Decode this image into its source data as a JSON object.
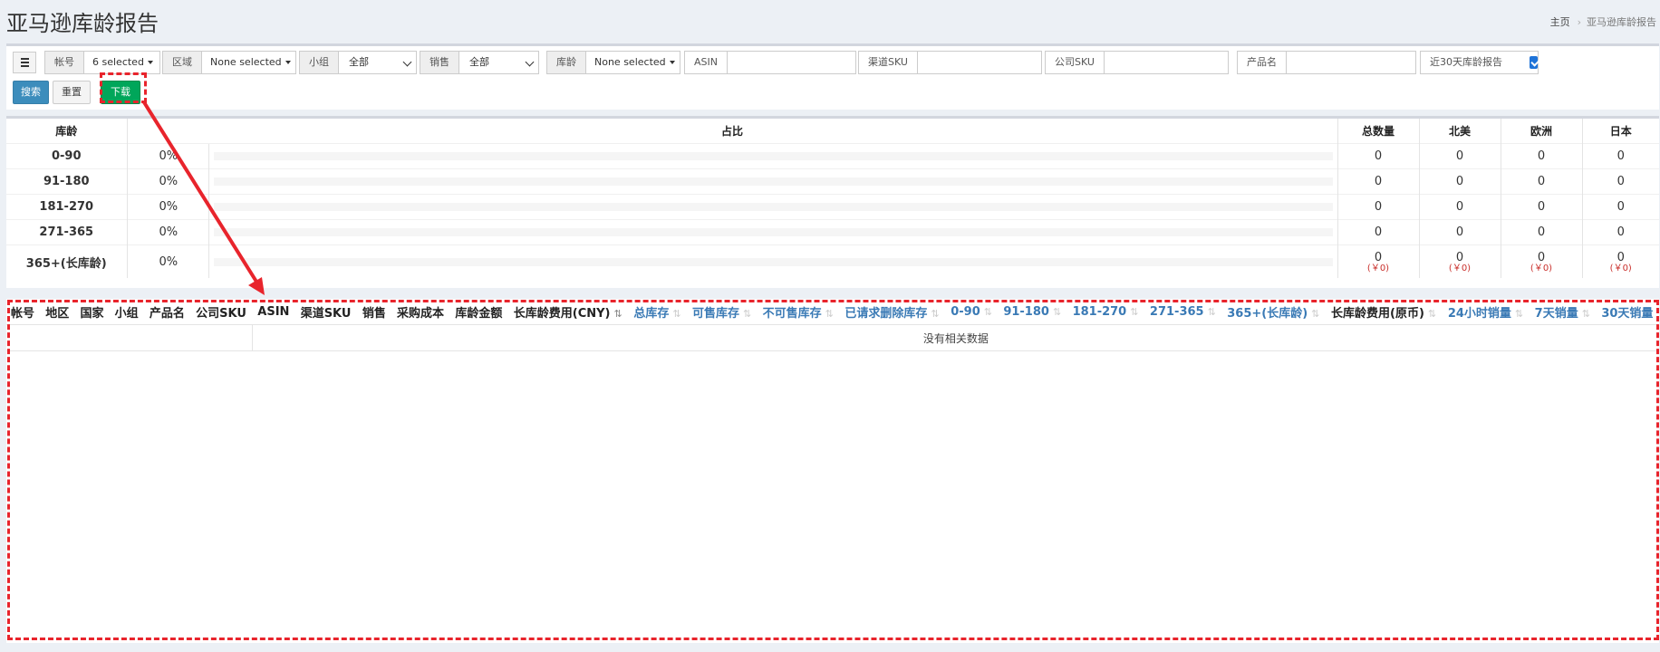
{
  "page": {
    "title": "亚马逊库龄报告"
  },
  "breadcrumb": {
    "home": "主页",
    "current": "亚马逊库龄报告"
  },
  "filters": {
    "account": {
      "label": "帐号",
      "value": "6 selected"
    },
    "region": {
      "label": "区域",
      "value": "None selected"
    },
    "group": {
      "label": "小组",
      "value": "全部"
    },
    "sales": {
      "label": "销售",
      "value": "全部"
    },
    "age": {
      "label": "库龄",
      "value": "None selected"
    },
    "asin": {
      "label": "ASIN",
      "value": ""
    },
    "channel_sku": {
      "label": "渠道SKU",
      "value": ""
    },
    "company_sku": {
      "label": "公司SKU",
      "value": ""
    },
    "product_name": {
      "label": "产品名",
      "value": ""
    },
    "recent30": {
      "label": "近30天库龄报告",
      "checked": true
    }
  },
  "buttons": {
    "search": "搜索",
    "reset": "重置",
    "download": "下载"
  },
  "age_summary": {
    "headers": [
      "库龄",
      "占比",
      "总数量",
      "北美",
      "欧洲",
      "日本"
    ],
    "rows": [
      {
        "label": "0-90",
        "pct": "0%",
        "total": "0",
        "na": "0",
        "eu": "0",
        "jp": "0"
      },
      {
        "label": "91-180",
        "pct": "0%",
        "total": "0",
        "na": "0",
        "eu": "0",
        "jp": "0"
      },
      {
        "label": "181-270",
        "pct": "0%",
        "total": "0",
        "na": "0",
        "eu": "0",
        "jp": "0"
      },
      {
        "label": "271-365",
        "pct": "0%",
        "total": "0",
        "na": "0",
        "eu": "0",
        "jp": "0"
      },
      {
        "label": "365+(长库龄)",
        "pct": "0%",
        "total": "0",
        "na": "0",
        "eu": "0",
        "jp": "0",
        "total_fee": "(￥0)",
        "na_fee": "(￥0)",
        "eu_fee": "(￥0)",
        "jp_fee": "(￥0)"
      }
    ]
  },
  "main_table": {
    "columns": [
      "帐号",
      "地区",
      "国家",
      "小组",
      "产品名",
      "公司SKU",
      "ASIN",
      "渠道SKU",
      "销售",
      "采购成本",
      "库龄金额",
      "长库龄费用(CNY)",
      "总库存",
      "可售库存",
      "不可售库存",
      "已请求删除库存",
      "0-90",
      "91-180",
      "181-270",
      "271-365",
      "365+(长库龄)",
      "长库龄费用(原币)",
      "24小时销量",
      "7天销量",
      "30天销量"
    ],
    "empty_message": "没有相关数据"
  },
  "colors": {
    "accent": "#3c8dbc",
    "success": "#00a65a",
    "annotation": "#e8242c",
    "sort_link": "#3a7ab5"
  }
}
